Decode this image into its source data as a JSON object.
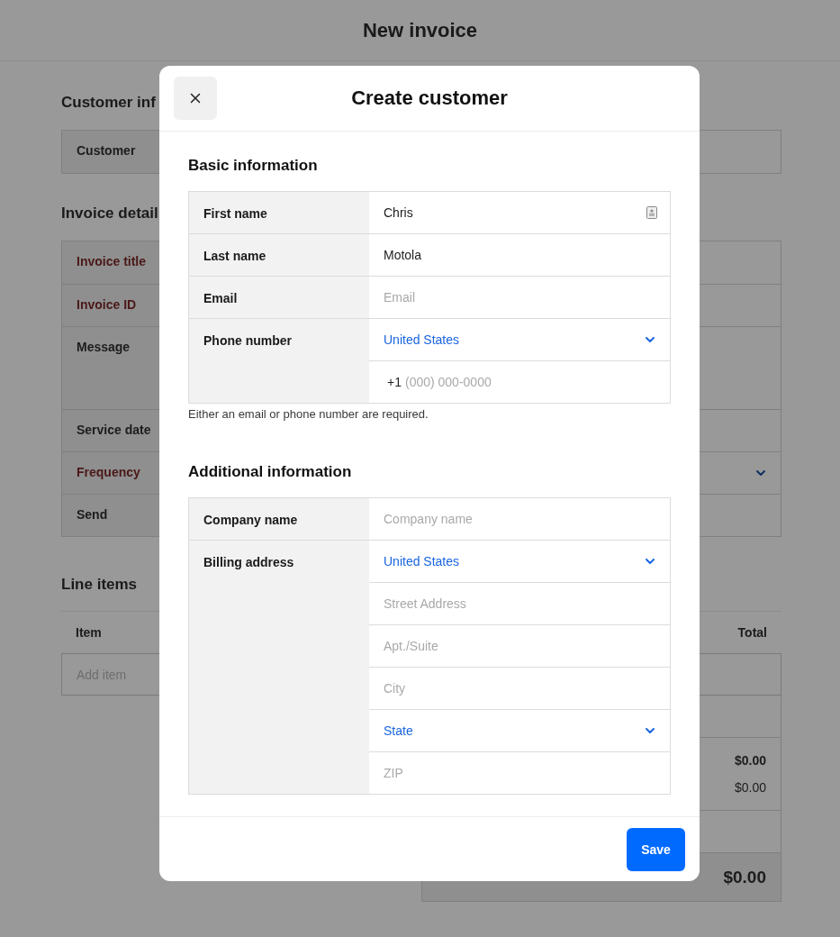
{
  "page": {
    "title": "New invoice",
    "sections": [
      {
        "heading": "Customer inf",
        "rows": [
          {
            "label": "Customer",
            "kind": "field",
            "required": false
          }
        ]
      },
      {
        "heading": "Invoice detail",
        "rows": [
          {
            "label": "Invoice title",
            "kind": "field",
            "required": true
          },
          {
            "label": "Invoice ID",
            "kind": "field",
            "required": true
          },
          {
            "label": "Message",
            "kind": "textarea",
            "required": false
          },
          {
            "label": "Service date",
            "kind": "field",
            "required": false
          },
          {
            "label": "Frequency",
            "kind": "select",
            "required": true
          },
          {
            "label": "Send",
            "kind": "field",
            "required": false
          }
        ]
      }
    ],
    "line_items": {
      "heading": "Line items",
      "columns": [
        "Item",
        "Total"
      ],
      "add_item_placeholder": "Add item",
      "amounts": [
        {
          "value": "$0.00",
          "bold": true
        },
        {
          "value": "$0.00",
          "bold": false
        }
      ],
      "total": "$0.00"
    }
  },
  "modal": {
    "title": "Create customer",
    "sections": [
      {
        "heading": "Basic information",
        "rows": [
          {
            "label": "First name",
            "inputs": [
              {
                "kind": "text",
                "value": "Chris",
                "contact_icon": true
              }
            ]
          },
          {
            "label": "Last name",
            "inputs": [
              {
                "kind": "text",
                "value": "Motola"
              }
            ]
          },
          {
            "label": "Email",
            "inputs": [
              {
                "kind": "text",
                "placeholder": "Email"
              }
            ]
          },
          {
            "label": "Phone number",
            "inputs": [
              {
                "kind": "select",
                "value": "United States"
              },
              {
                "kind": "phone",
                "prefix": "+1",
                "placeholder": "(000) 000-0000"
              }
            ]
          }
        ],
        "note": "Either an email or phone number are required."
      },
      {
        "heading": "Additional information",
        "rows": [
          {
            "label": "Company name",
            "inputs": [
              {
                "kind": "text",
                "placeholder": "Company name"
              }
            ]
          },
          {
            "label": "Billing address",
            "inputs": [
              {
                "kind": "select",
                "value": "United States"
              },
              {
                "kind": "text",
                "placeholder": "Street Address"
              },
              {
                "kind": "text",
                "placeholder": "Apt./Suite"
              },
              {
                "kind": "text",
                "placeholder": "City"
              },
              {
                "kind": "select",
                "value": "State"
              },
              {
                "kind": "text",
                "placeholder": "ZIP"
              }
            ]
          }
        ]
      }
    ],
    "save_label": "Save"
  }
}
